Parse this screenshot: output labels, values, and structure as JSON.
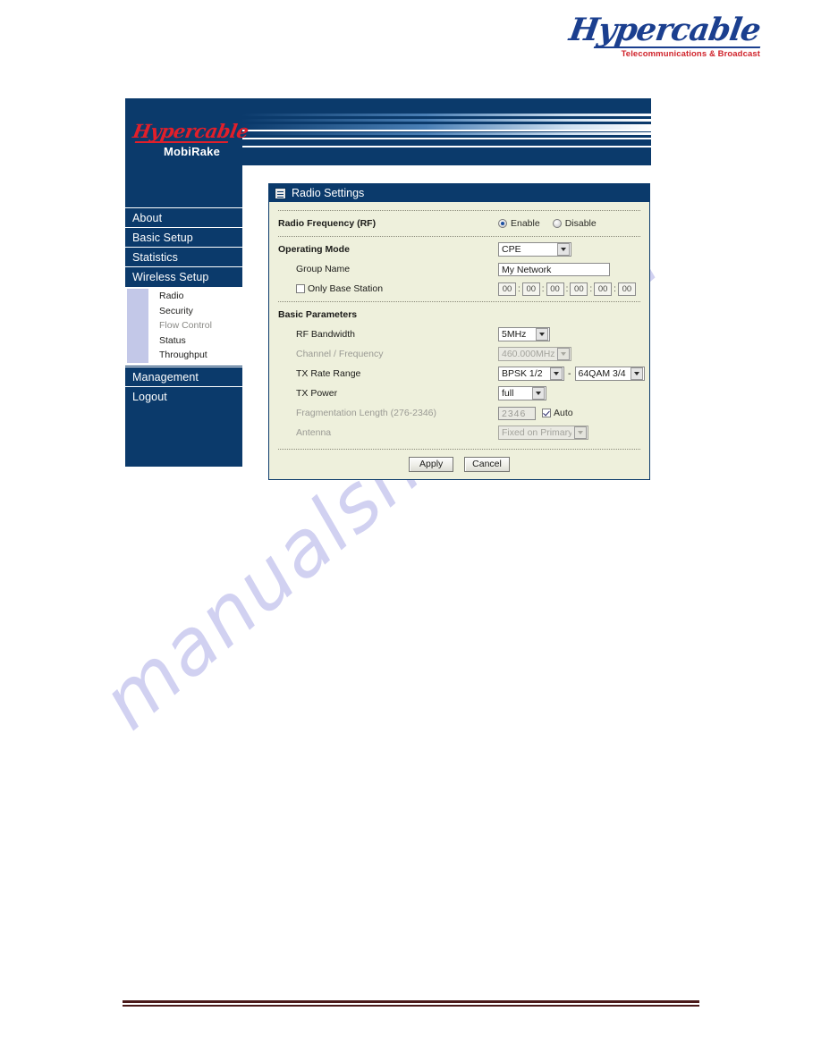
{
  "brand": {
    "word": "Hypercable",
    "tagline": "Telecommunications & Broadcast"
  },
  "sidebar": {
    "brand_word": "Hypercable",
    "product": "MobiRake",
    "items": [
      {
        "label": "About"
      },
      {
        "label": "Basic Setup"
      },
      {
        "label": "Statistics"
      },
      {
        "label": "Wireless Setup"
      },
      {
        "label": "Management"
      },
      {
        "label": "Logout"
      }
    ],
    "submenu": [
      {
        "label": "Radio"
      },
      {
        "label": "Security"
      },
      {
        "label": "Flow Control"
      },
      {
        "label": "Status"
      },
      {
        "label": "Throughput"
      }
    ]
  },
  "panel": {
    "title": "Radio Settings",
    "title_icon": "list-icon",
    "rf": {
      "label": "Radio Frequency (RF)",
      "enable_label": "Enable",
      "disable_label": "Disable",
      "selected": "Enable"
    },
    "operating_mode": {
      "label": "Operating Mode",
      "value": "CPE"
    },
    "group_name": {
      "label": "Group Name",
      "value": "My Network"
    },
    "only_base_station": {
      "label": "Only Base Station",
      "checked": false,
      "mac": [
        "00",
        "00",
        "00",
        "00",
        "00",
        "00"
      ],
      "separator": ":"
    },
    "basic_parameters": {
      "heading": "Basic Parameters",
      "rf_bandwidth": {
        "label": "RF Bandwidth",
        "value": "5MHz"
      },
      "channel_frequency": {
        "label": "Channel / Frequency",
        "value": "460.000MHz",
        "disabled": true
      },
      "tx_rate_range": {
        "label": "TX Rate Range",
        "from": "BPSK 1/2",
        "dash": "-",
        "to": "64QAM 3/4"
      },
      "tx_power": {
        "label": "TX Power",
        "value": "full"
      },
      "fragmentation": {
        "label": "Fragmentation Length (276-2346)",
        "value": "2346",
        "auto_label": "Auto",
        "auto_checked": true,
        "disabled": true
      },
      "antenna": {
        "label": "Antenna",
        "value": "Fixed on Primary",
        "disabled": true
      }
    },
    "buttons": {
      "apply": "Apply",
      "cancel": "Cancel"
    }
  },
  "watermark": {
    "text": "manualshive.com"
  },
  "colors": {
    "navy": "#0b3a6b",
    "panel_bg": "#eef0dc",
    "brand_blue": "#1b3f8f",
    "brand_red": "#d0232b",
    "footer_rule": "#4a1a1a",
    "watermark": "#c9c9ef"
  }
}
